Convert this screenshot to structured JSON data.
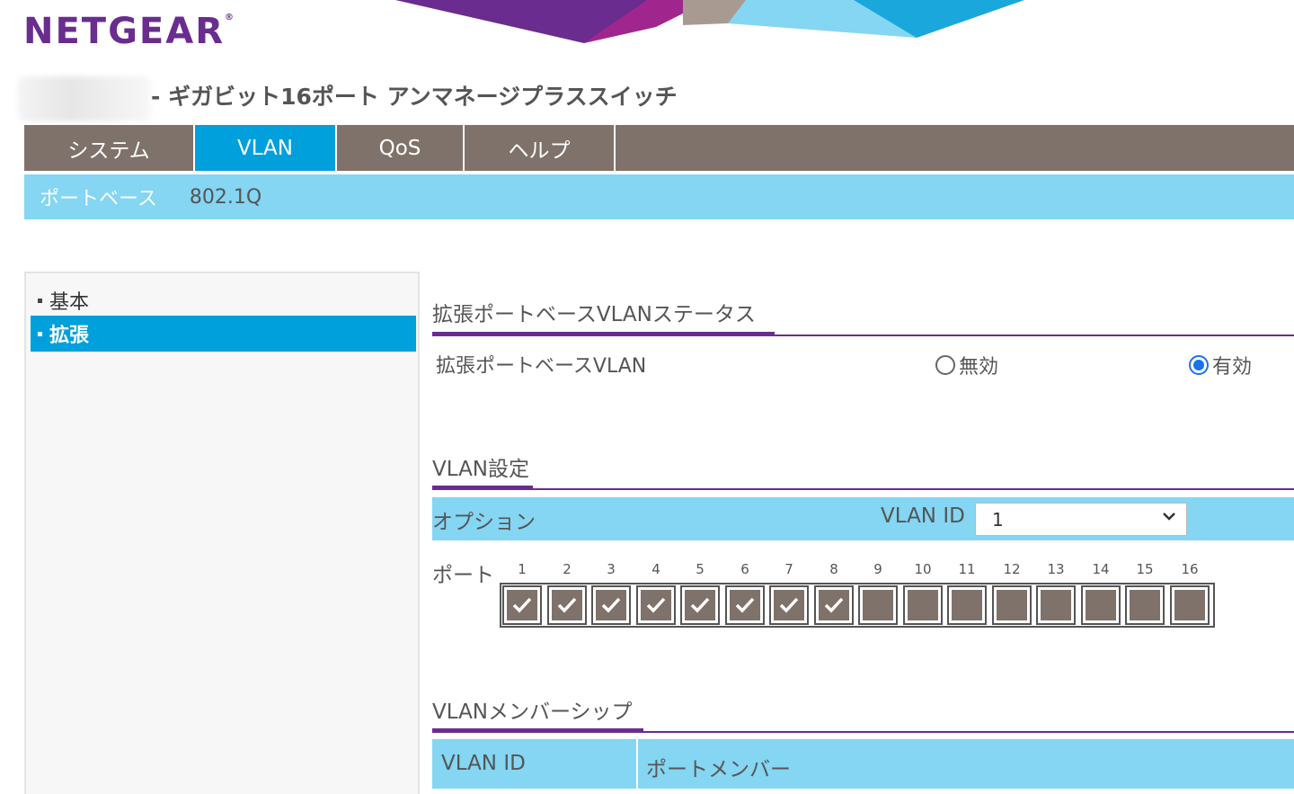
{
  "brand": {
    "logo_text": "NETGEAR",
    "logo_mark": "®"
  },
  "product_title": "- ギガビット16ポート アンマネージプラススイッチ",
  "main_nav": [
    {
      "label": "システム",
      "active": false
    },
    {
      "label": "VLAN",
      "active": true
    },
    {
      "label": "QoS",
      "active": false
    },
    {
      "label": "ヘルプ",
      "active": false
    }
  ],
  "sub_nav": [
    {
      "label": "ポートベース",
      "active": true
    },
    {
      "label": "802.1Q",
      "active": false
    }
  ],
  "sidebar": {
    "items": [
      {
        "label": "基本",
        "active": false
      },
      {
        "label": "拡張",
        "active": true
      }
    ]
  },
  "status_section": {
    "title": "拡張ポートベースVLANステータス",
    "row_label": "拡張ポートベースVLAN",
    "options": [
      {
        "label": "無効",
        "checked": false
      },
      {
        "label": "有効",
        "checked": true
      }
    ]
  },
  "settings_section": {
    "title": "VLAN設定",
    "option_label": "オプション",
    "vlan_id_label": "VLAN ID",
    "vlan_id_value": "1",
    "port_label": "ポート",
    "ports": [
      {
        "number": "1",
        "checked": true
      },
      {
        "number": "2",
        "checked": true
      },
      {
        "number": "3",
        "checked": true
      },
      {
        "number": "4",
        "checked": true
      },
      {
        "number": "5",
        "checked": true
      },
      {
        "number": "6",
        "checked": true
      },
      {
        "number": "7",
        "checked": true
      },
      {
        "number": "8",
        "checked": true
      },
      {
        "number": "9",
        "checked": false
      },
      {
        "number": "10",
        "checked": false
      },
      {
        "number": "11",
        "checked": false
      },
      {
        "number": "12",
        "checked": false
      },
      {
        "number": "13",
        "checked": false
      },
      {
        "number": "14",
        "checked": false
      },
      {
        "number": "15",
        "checked": false
      },
      {
        "number": "16",
        "checked": false
      }
    ]
  },
  "membership_section": {
    "title": "VLANメンバーシップ",
    "columns": [
      "VLAN ID",
      "ポートメンバー"
    ]
  },
  "colors": {
    "brand_purple": "#6a2c8e",
    "nav_taupe": "#7e726a",
    "active_blue": "#00a0dc",
    "light_blue": "#84d6f2"
  }
}
